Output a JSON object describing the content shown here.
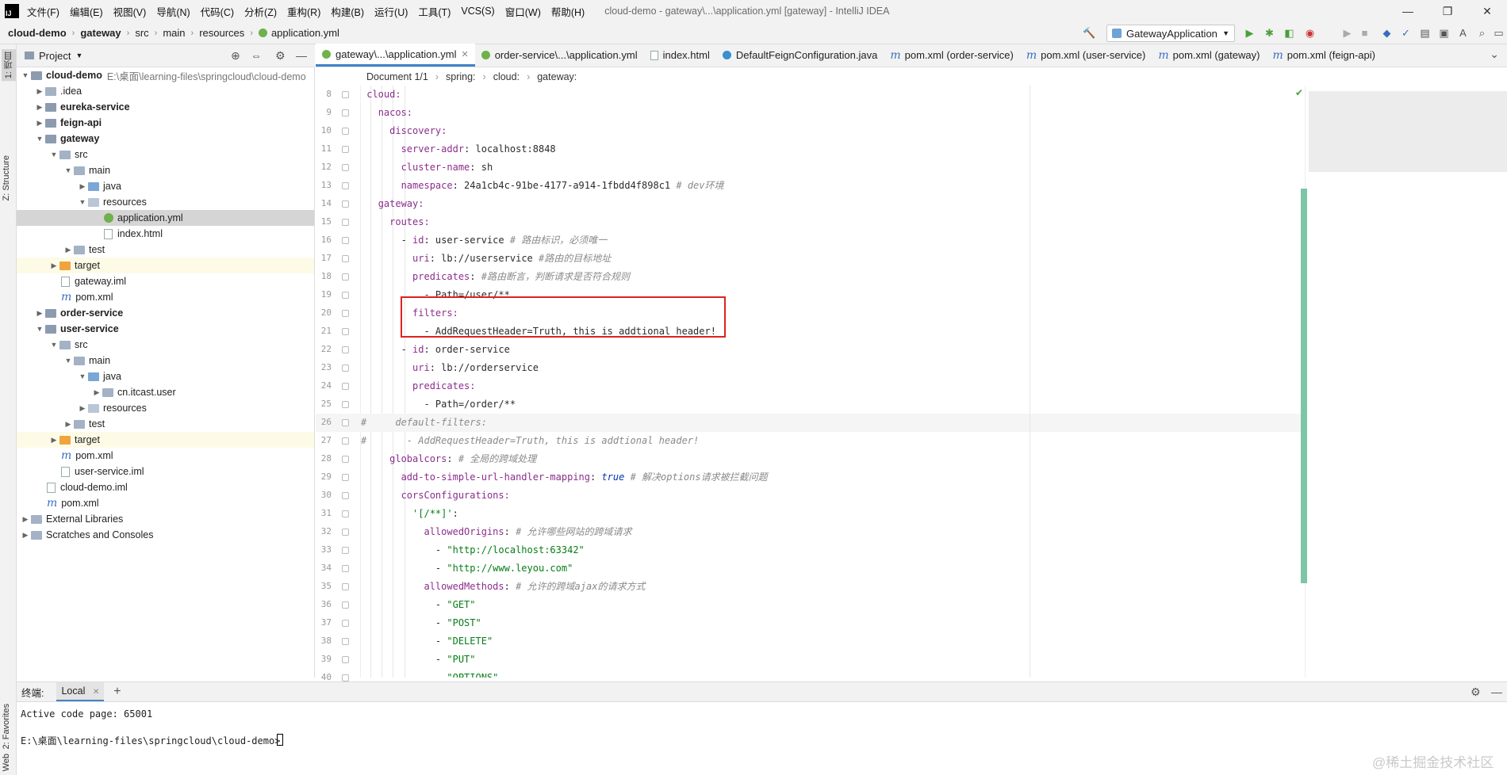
{
  "app": {
    "logo": "IJ",
    "window_title": "cloud-demo - gateway\\...\\application.yml [gateway] - IntelliJ IDEA"
  },
  "menu": [
    "文件(F)",
    "编辑(E)",
    "视图(V)",
    "导航(N)",
    "代码(C)",
    "分析(Z)",
    "重构(R)",
    "构建(B)",
    "运行(U)",
    "工具(T)",
    "VCS(S)",
    "窗口(W)",
    "帮助(H)"
  ],
  "window_controls": {
    "minimize": "—",
    "restore": "❐",
    "close": "✕"
  },
  "navbar": {
    "crumbs": [
      "cloud-demo",
      "gateway",
      "src",
      "main",
      "resources",
      "application.yml"
    ],
    "run_config": "GatewayApplication"
  },
  "left_strip": {
    "project_tab": "1: 项目",
    "structure_tab": "Z: Structure",
    "favorites_tab": "2: Favorites",
    "web_tab": "Web"
  },
  "project_panel": {
    "title": "Project"
  },
  "tree": [
    {
      "label": "cloud-demo",
      "extra": "E:\\桌面\\learning-files\\springcloud\\cloud-demo",
      "depth": 0,
      "arrow": "▼",
      "icon": "mod",
      "bold": true
    },
    {
      "label": ".idea",
      "depth": 1,
      "arrow": "▶",
      "icon": "fold"
    },
    {
      "label": "eureka-service",
      "depth": 1,
      "arrow": "▶",
      "icon": "mod",
      "bold": true
    },
    {
      "label": "feign-api",
      "depth": 1,
      "arrow": "▶",
      "icon": "mod",
      "bold": true
    },
    {
      "label": "gateway",
      "depth": 1,
      "arrow": "▼",
      "icon": "mod",
      "bold": true
    },
    {
      "label": "src",
      "depth": 2,
      "arrow": "▼",
      "icon": "fold"
    },
    {
      "label": "main",
      "depth": 3,
      "arrow": "▼",
      "icon": "fold"
    },
    {
      "label": "java",
      "depth": 4,
      "arrow": "▶",
      "icon": "blue"
    },
    {
      "label": "resources",
      "depth": 4,
      "arrow": "▼",
      "icon": "src"
    },
    {
      "label": "application.yml",
      "depth": 5,
      "arrow": "",
      "icon": "yml",
      "selected": true
    },
    {
      "label": "index.html",
      "depth": 5,
      "arrow": "",
      "icon": "file"
    },
    {
      "label": "test",
      "depth": 3,
      "arrow": "▶",
      "icon": "fold"
    },
    {
      "label": "target",
      "depth": 2,
      "arrow": "▶",
      "icon": "orange",
      "target": true
    },
    {
      "label": "gateway.iml",
      "depth": 2,
      "arrow": "",
      "icon": "file"
    },
    {
      "label": "pom.xml",
      "depth": 2,
      "arrow": "",
      "icon": "m"
    },
    {
      "label": "order-service",
      "depth": 1,
      "arrow": "▶",
      "icon": "mod",
      "bold": true
    },
    {
      "label": "user-service",
      "depth": 1,
      "arrow": "▼",
      "icon": "mod",
      "bold": true
    },
    {
      "label": "src",
      "depth": 2,
      "arrow": "▼",
      "icon": "fold"
    },
    {
      "label": "main",
      "depth": 3,
      "arrow": "▼",
      "icon": "fold"
    },
    {
      "label": "java",
      "depth": 4,
      "arrow": "▼",
      "icon": "blue"
    },
    {
      "label": "cn.itcast.user",
      "depth": 5,
      "arrow": "▶",
      "icon": "fold"
    },
    {
      "label": "resources",
      "depth": 4,
      "arrow": "▶",
      "icon": "src"
    },
    {
      "label": "test",
      "depth": 3,
      "arrow": "▶",
      "icon": "fold"
    },
    {
      "label": "target",
      "depth": 2,
      "arrow": "▶",
      "icon": "orange",
      "target": true
    },
    {
      "label": "pom.xml",
      "depth": 2,
      "arrow": "",
      "icon": "m"
    },
    {
      "label": "user-service.iml",
      "depth": 2,
      "arrow": "",
      "icon": "file"
    },
    {
      "label": "cloud-demo.iml",
      "depth": 1,
      "arrow": "",
      "icon": "file"
    },
    {
      "label": "pom.xml",
      "depth": 1,
      "arrow": "",
      "icon": "m"
    },
    {
      "label": "External Libraries",
      "depth": 0,
      "arrow": "▶",
      "icon": "fold"
    },
    {
      "label": "Scratches and Consoles",
      "depth": 0,
      "arrow": "▶",
      "icon": "fold"
    }
  ],
  "tabs": [
    {
      "label": "gateway\\...\\application.yml",
      "active": true
    },
    {
      "label": "order-service\\...\\application.yml"
    },
    {
      "label": "index.html"
    },
    {
      "label": "DefaultFeignConfiguration.java"
    },
    {
      "label": "pom.xml (order-service)"
    },
    {
      "label": "pom.xml (user-service)"
    },
    {
      "label": "pom.xml (gateway)"
    },
    {
      "label": "pom.xml (feign-api)"
    }
  ],
  "editor_breadcrumb": [
    "Document 1/1",
    "spring:",
    "cloud:",
    "gateway:"
  ],
  "code_lines": [
    {
      "n": "8",
      "indent": 0,
      "parts": [
        [
          "k",
          "cloud:"
        ]
      ]
    },
    {
      "n": "9",
      "indent": 2,
      "parts": [
        [
          "k",
          "nacos:"
        ]
      ]
    },
    {
      "n": "10",
      "indent": 4,
      "parts": [
        [
          "k",
          "discovery:"
        ]
      ]
    },
    {
      "n": "11",
      "indent": 6,
      "parts": [
        [
          "k",
          "server-addr"
        ],
        [
          "v",
          ": localhost:8848"
        ]
      ]
    },
    {
      "n": "12",
      "indent": 6,
      "parts": [
        [
          "k",
          "cluster-name"
        ],
        [
          "v",
          ": sh"
        ]
      ]
    },
    {
      "n": "13",
      "indent": 6,
      "parts": [
        [
          "k",
          "namespace"
        ],
        [
          "v",
          ": 24a1cb4c-91be-4177-a914-1fbdd4f898c1 "
        ],
        [
          "c",
          "# dev环境"
        ]
      ]
    },
    {
      "n": "14",
      "indent": 2,
      "parts": [
        [
          "k",
          "gateway:"
        ]
      ]
    },
    {
      "n": "15",
      "indent": 4,
      "parts": [
        [
          "k",
          "routes:"
        ]
      ]
    },
    {
      "n": "16",
      "indent": 6,
      "parts": [
        [
          "v",
          "- "
        ],
        [
          "k",
          "id"
        ],
        [
          "v",
          ": user-service "
        ],
        [
          "c",
          "# 路由标识，必须唯一"
        ]
      ]
    },
    {
      "n": "17",
      "indent": 8,
      "parts": [
        [
          "k",
          "uri"
        ],
        [
          "v",
          ": lb://userservice "
        ],
        [
          "c",
          "#路由的目标地址"
        ]
      ]
    },
    {
      "n": "18",
      "indent": 8,
      "parts": [
        [
          "k",
          "predicates"
        ],
        [
          "v",
          ": "
        ],
        [
          "c",
          "#路由断言，判断请求是否符合规则"
        ]
      ]
    },
    {
      "n": "19",
      "indent": 10,
      "parts": [
        [
          "v",
          "- Path=/user/**"
        ]
      ]
    },
    {
      "n": "20",
      "indent": 8,
      "parts": [
        [
          "k",
          "filters:"
        ]
      ]
    },
    {
      "n": "21",
      "indent": 10,
      "parts": [
        [
          "v",
          "- AddRequestHeader=Truth, this is addtional header!"
        ]
      ]
    },
    {
      "n": "22",
      "indent": 6,
      "parts": [
        [
          "v",
          "- "
        ],
        [
          "k",
          "id"
        ],
        [
          "v",
          ": order-service"
        ]
      ]
    },
    {
      "n": "23",
      "indent": 8,
      "parts": [
        [
          "k",
          "uri"
        ],
        [
          "v",
          ": lb://orderservice"
        ]
      ]
    },
    {
      "n": "24",
      "indent": 8,
      "parts": [
        [
          "k",
          "predicates:"
        ]
      ]
    },
    {
      "n": "25",
      "indent": 10,
      "parts": [
        [
          "v",
          "- Path=/order/**"
        ]
      ]
    },
    {
      "n": "26",
      "indent": 0,
      "hl": true,
      "parts": [
        [
          "c",
          "#     default-filters:"
        ]
      ]
    },
    {
      "n": "27",
      "indent": 0,
      "parts": [
        [
          "c",
          "#       - AddRequestHeader=Truth, this is addtional header!"
        ]
      ]
    },
    {
      "n": "28",
      "indent": 4,
      "parts": [
        [
          "k",
          "globalcors"
        ],
        [
          "v",
          ": "
        ],
        [
          "c",
          "# 全局的跨域处理"
        ]
      ]
    },
    {
      "n": "29",
      "indent": 6,
      "parts": [
        [
          "k",
          "add-to-simple-url-handler-mapping"
        ],
        [
          "v",
          ": "
        ],
        [
          "bl",
          "true"
        ],
        [
          "c",
          " # 解决options请求被拦截问题"
        ]
      ]
    },
    {
      "n": "30",
      "indent": 6,
      "parts": [
        [
          "k",
          "corsConfigurations:"
        ]
      ]
    },
    {
      "n": "31",
      "indent": 8,
      "parts": [
        [
          "s",
          "'[/**]'"
        ],
        [
          "v",
          ":"
        ]
      ]
    },
    {
      "n": "32",
      "indent": 10,
      "parts": [
        [
          "k",
          "allowedOrigins"
        ],
        [
          "v",
          ": "
        ],
        [
          "c",
          "# 允许哪些网站的跨域请求"
        ]
      ]
    },
    {
      "n": "33",
      "indent": 12,
      "parts": [
        [
          "v",
          "- "
        ],
        [
          "s",
          "\"http://localhost:63342\""
        ]
      ]
    },
    {
      "n": "34",
      "indent": 12,
      "parts": [
        [
          "v",
          "- "
        ],
        [
          "s",
          "\"http://www.leyou.com\""
        ]
      ]
    },
    {
      "n": "35",
      "indent": 10,
      "parts": [
        [
          "k",
          "allowedMethods"
        ],
        [
          "v",
          ": "
        ],
        [
          "c",
          "# 允许的跨域ajax的请求方式"
        ]
      ]
    },
    {
      "n": "36",
      "indent": 12,
      "parts": [
        [
          "v",
          "- "
        ],
        [
          "s",
          "\"GET\""
        ]
      ]
    },
    {
      "n": "37",
      "indent": 12,
      "parts": [
        [
          "v",
          "- "
        ],
        [
          "s",
          "\"POST\""
        ]
      ]
    },
    {
      "n": "38",
      "indent": 12,
      "parts": [
        [
          "v",
          "- "
        ],
        [
          "s",
          "\"DELETE\""
        ]
      ]
    },
    {
      "n": "39",
      "indent": 12,
      "parts": [
        [
          "v",
          "- "
        ],
        [
          "s",
          "\"PUT\""
        ]
      ]
    },
    {
      "n": "40",
      "indent": 12,
      "parts": [
        [
          "v",
          "- "
        ],
        [
          "s",
          "\"OPTIONS\""
        ]
      ]
    }
  ],
  "terminal": {
    "title": "终端:",
    "tab": "Local",
    "lines": [
      "Active code page: 65001",
      "",
      "E:\\桌面\\learning-files\\springcloud\\cloud-demo>"
    ]
  },
  "watermark": "@稀土掘金技术社区",
  "colors": {
    "accent": "#4083c9",
    "highlight_box": "#dd2222",
    "yaml_key": "#8c2e8c",
    "comment": "#8a8a8a"
  }
}
